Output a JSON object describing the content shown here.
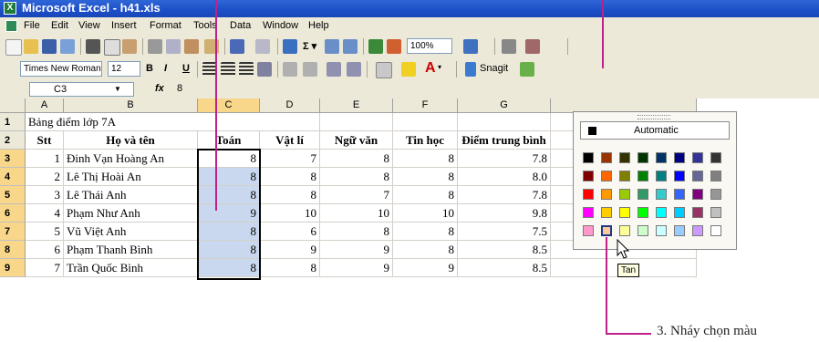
{
  "window": {
    "title": "Microsoft Excel - h41.xls"
  },
  "menu": [
    "File",
    "Edit",
    "View",
    "Insert",
    "Format",
    "Tools",
    "Data",
    "Window",
    "Help"
  ],
  "toolbar": {
    "zoom": "100%"
  },
  "format_toolbar": {
    "font": "Times New Roman",
    "size": "12",
    "bold": "B",
    "italic": "I",
    "underline": "U",
    "snagit": "Snagit"
  },
  "formula_bar": {
    "name_box": "C3",
    "fx": "fx",
    "value": "8"
  },
  "columns": [
    "A",
    "B",
    "C",
    "D",
    "E",
    "F",
    "G"
  ],
  "rows": [
    "1",
    "2",
    "3",
    "4",
    "5",
    "6",
    "7",
    "8",
    "9"
  ],
  "sheet": {
    "title": "Bảng điểm lớp 7A",
    "headers": [
      "Stt",
      "Họ và tên",
      "Toán",
      "Vật lí",
      "Ngữ văn",
      "Tin học",
      "Điểm trung bình"
    ],
    "data": [
      [
        "1",
        "Đinh Vạn Hoàng An",
        "8",
        "7",
        "8",
        "8",
        "7.8"
      ],
      [
        "2",
        "Lê Thị Hoài An",
        "8",
        "8",
        "8",
        "8",
        "8.0"
      ],
      [
        "3",
        "Lê Thái Anh",
        "8",
        "8",
        "7",
        "8",
        "7.8"
      ],
      [
        "4",
        "Phạm Như Anh",
        "9",
        "10",
        "10",
        "10",
        "9.8"
      ],
      [
        "5",
        "Vũ Việt Anh",
        "8",
        "6",
        "8",
        "8",
        "7.5"
      ],
      [
        "6",
        "Phạm Thanh Bình",
        "8",
        "9",
        "9",
        "8",
        "8.5"
      ],
      [
        "7",
        "Trần Quốc Bình",
        "8",
        "8",
        "9",
        "9",
        "8.5"
      ]
    ]
  },
  "palette": {
    "automatic": "Automatic",
    "colors": [
      [
        "#000000",
        "#993300",
        "#333300",
        "#003300",
        "#003366",
        "#000080",
        "#333399",
        "#333333"
      ],
      [
        "#800000",
        "#FF6600",
        "#808000",
        "#008000",
        "#008080",
        "#0000FF",
        "#666699",
        "#808080"
      ],
      [
        "#FF0000",
        "#FF9900",
        "#99CC00",
        "#339966",
        "#33CCCC",
        "#3366FF",
        "#800080",
        "#969696"
      ],
      [
        "#FF00FF",
        "#FFCC00",
        "#FFFF00",
        "#00FF00",
        "#00FFFF",
        "#00CCFF",
        "#993366",
        "#C0C0C0"
      ],
      [
        "#FF99CC",
        "#FFCC99",
        "#FFFF99",
        "#CCFFCC",
        "#CCFFFF",
        "#99CCFF",
        "#CC99FF",
        "#FFFFFF"
      ]
    ],
    "tooltip": "Tan"
  },
  "annotation": {
    "text": "3. Nháy chọn màu",
    "color": "#c0208a"
  }
}
